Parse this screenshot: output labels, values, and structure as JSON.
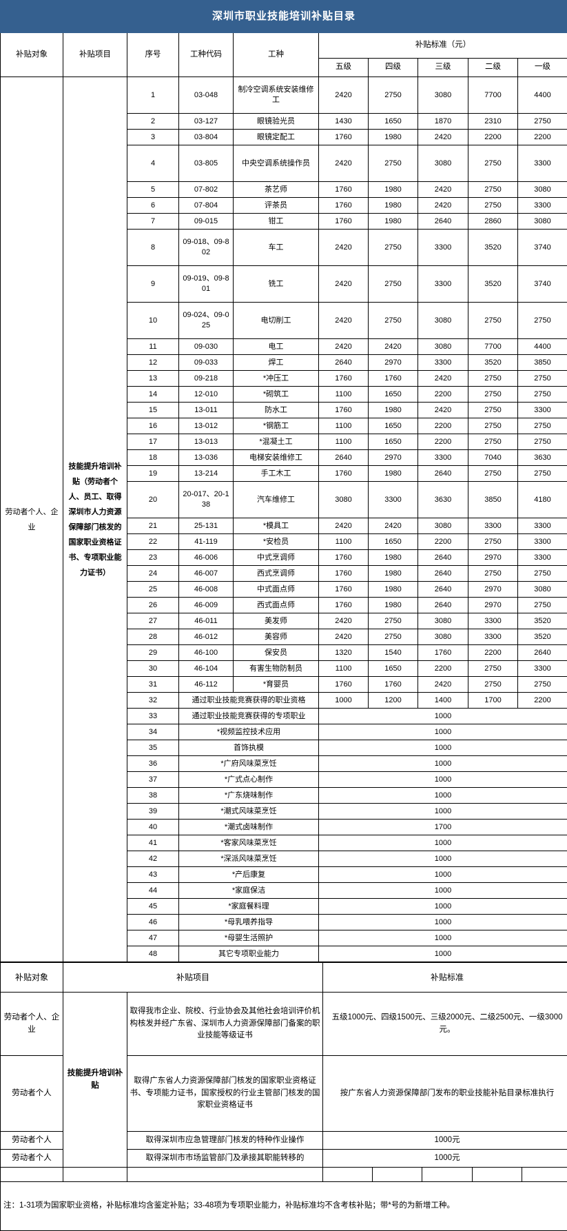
{
  "document": {
    "title": "深圳市职业技能培训补贴目录"
  },
  "table1": {
    "headers": {
      "col_object": "补贴对象",
      "col_program": "补贴项目",
      "col_index": "序号",
      "col_code": "工种代码",
      "col_trade": "工种",
      "col_standard": "补贴标准（元）",
      "levels": [
        "五级",
        "四级",
        "三级",
        "二级",
        "一级"
      ]
    },
    "category_label": "劳动者个人、企业",
    "program_label": "技能提升培训补贴（劳动者个人、员工、取得深圳市人力资源保障部门核发的国家职业资格证书、专项职业能力证书）",
    "rows": [
      {
        "no": "1",
        "code": "03-048",
        "trade": "制冷空调系统安装维修工",
        "v": [
          "2420",
          "2750",
          "3080",
          "7700",
          "4400"
        ],
        "h": "lg"
      },
      {
        "no": "2",
        "code": "03-127",
        "trade": "眼镜验光员",
        "v": [
          "1430",
          "1650",
          "1870",
          "2310",
          "2750"
        ],
        "h": "sm"
      },
      {
        "no": "3",
        "code": "03-804",
        "trade": "眼镜定配工",
        "v": [
          "1760",
          "1980",
          "2420",
          "2200",
          "2200"
        ],
        "h": "sm"
      },
      {
        "no": "4",
        "code": "03-805",
        "trade": "中央空调系统操作员",
        "v": [
          "2420",
          "2750",
          "3080",
          "2750",
          "3300"
        ],
        "h": "lg"
      },
      {
        "no": "5",
        "code": "07-802",
        "trade": "茶艺师",
        "v": [
          "1760",
          "1980",
          "2420",
          "2750",
          "3080"
        ],
        "h": "sm"
      },
      {
        "no": "6",
        "code": "07-804",
        "trade": "评茶员",
        "v": [
          "1760",
          "1980",
          "2420",
          "2750",
          "3300"
        ],
        "h": "sm"
      },
      {
        "no": "7",
        "code": "09-015",
        "trade": "钳工",
        "v": [
          "1760",
          "1980",
          "2640",
          "2860",
          "3080"
        ],
        "h": "sm"
      },
      {
        "no": "8",
        "code": "09-018、09-802",
        "trade": "车工",
        "v": [
          "2420",
          "2750",
          "3300",
          "3520",
          "3740"
        ],
        "h": "lg"
      },
      {
        "no": "9",
        "code": "09-019、09-801",
        "trade": "铣工",
        "v": [
          "2420",
          "2750",
          "3300",
          "3520",
          "3740"
        ],
        "h": "lg"
      },
      {
        "no": "10",
        "code": "09-024、09-025",
        "trade": "电切削工",
        "v": [
          "2420",
          "2750",
          "3080",
          "2750",
          "2750"
        ],
        "h": "lg"
      },
      {
        "no": "11",
        "code": "09-030",
        "trade": "电工",
        "v": [
          "2420",
          "2420",
          "3080",
          "7700",
          "4400"
        ],
        "h": "sm"
      },
      {
        "no": "12",
        "code": "09-033",
        "trade": "焊工",
        "v": [
          "2640",
          "2970",
          "3300",
          "3520",
          "3850"
        ],
        "h": "sm"
      },
      {
        "no": "13",
        "code": "09-218",
        "trade": "*冲压工",
        "v": [
          "1760",
          "1760",
          "2420",
          "2750",
          "2750"
        ],
        "h": "sm"
      },
      {
        "no": "14",
        "code": "12-010",
        "trade": "*砌筑工",
        "v": [
          "1100",
          "1650",
          "2200",
          "2750",
          "2750"
        ],
        "h": "sm"
      },
      {
        "no": "15",
        "code": "13-011",
        "trade": "防水工",
        "v": [
          "1760",
          "1980",
          "2420",
          "2750",
          "3300"
        ],
        "h": "sm"
      },
      {
        "no": "16",
        "code": "13-012",
        "trade": "*钢筋工",
        "v": [
          "1100",
          "1650",
          "2200",
          "2750",
          "2750"
        ],
        "h": "sm"
      },
      {
        "no": "17",
        "code": "13-013",
        "trade": "*混凝土工",
        "v": [
          "1100",
          "1650",
          "2200",
          "2750",
          "2750"
        ],
        "h": "sm"
      },
      {
        "no": "18",
        "code": "13-036",
        "trade": "电梯安装维修工",
        "v": [
          "2640",
          "2970",
          "3300",
          "7040",
          "3630"
        ],
        "h": "sm"
      },
      {
        "no": "19",
        "code": "13-214",
        "trade": "手工木工",
        "v": [
          "1760",
          "1980",
          "2640",
          "2750",
          "2750"
        ],
        "h": "sm"
      },
      {
        "no": "20",
        "code": "20-017、20-138",
        "trade": "汽车维修工",
        "v": [
          "3080",
          "3300",
          "3630",
          "3850",
          "4180"
        ],
        "h": "lg"
      },
      {
        "no": "21",
        "code": "25-131",
        "trade": "*模具工",
        "v": [
          "2420",
          "2420",
          "3080",
          "3300",
          "3300"
        ],
        "h": "sm"
      },
      {
        "no": "22",
        "code": "41-119",
        "trade": "*安检员",
        "v": [
          "1100",
          "1650",
          "2200",
          "2750",
          "3300"
        ],
        "h": "sm"
      },
      {
        "no": "23",
        "code": "46-006",
        "trade": "中式烹调师",
        "v": [
          "1760",
          "1980",
          "2640",
          "2970",
          "3300"
        ],
        "h": "sm"
      },
      {
        "no": "24",
        "code": "46-007",
        "trade": "西式烹调师",
        "v": [
          "1760",
          "1980",
          "2640",
          "2750",
          "2750"
        ],
        "h": "sm"
      },
      {
        "no": "25",
        "code": "46-008",
        "trade": "中式面点师",
        "v": [
          "1760",
          "1980",
          "2640",
          "2970",
          "3080"
        ],
        "h": "sm"
      },
      {
        "no": "26",
        "code": "46-009",
        "trade": "西式面点师",
        "v": [
          "1760",
          "1980",
          "2640",
          "2970",
          "2750"
        ],
        "h": "sm"
      },
      {
        "no": "27",
        "code": "46-011",
        "trade": "美发师",
        "v": [
          "2420",
          "2750",
          "3080",
          "3300",
          "3520"
        ],
        "h": "sm"
      },
      {
        "no": "28",
        "code": "46-012",
        "trade": "美容师",
        "v": [
          "2420",
          "2750",
          "3080",
          "3300",
          "3520"
        ],
        "h": "sm"
      },
      {
        "no": "29",
        "code": "46-100",
        "trade": "保安员",
        "v": [
          "1320",
          "1540",
          "1760",
          "2200",
          "2640"
        ],
        "h": "sm"
      },
      {
        "no": "30",
        "code": "46-104",
        "trade": "有害生物防制员",
        "v": [
          "1100",
          "1650",
          "2200",
          "2750",
          "3300"
        ],
        "h": "sm"
      },
      {
        "no": "31",
        "code": "46-112",
        "trade": "*育婴员",
        "v": [
          "1760",
          "1760",
          "2420",
          "2750",
          "2750"
        ],
        "h": "sm"
      }
    ],
    "wide_rows": [
      {
        "no": "32",
        "trade": "通过职业技能竞赛获得的职业资格",
        "v": [
          "1000",
          "1200",
          "1400",
          "1700",
          "2200"
        ],
        "merged": false
      },
      {
        "no": "33",
        "trade": "通过职业技能竞赛获得的专项职业",
        "value": "1000",
        "merged": true
      },
      {
        "no": "34",
        "trade": "*视频监控技术应用",
        "value": "1000",
        "merged": true
      },
      {
        "no": "35",
        "trade": "首饰执模",
        "value": "1000",
        "merged": true
      },
      {
        "no": "36",
        "trade": "*广府风味菜烹饪",
        "value": "1000",
        "merged": true
      },
      {
        "no": "37",
        "trade": "*广式点心制作",
        "value": "1000",
        "merged": true
      },
      {
        "no": "38",
        "trade": "*广东烧味制作",
        "value": "1000",
        "merged": true
      },
      {
        "no": "39",
        "trade": "*潮式风味菜烹饪",
        "value": "1000",
        "merged": true
      },
      {
        "no": "40",
        "trade": "*潮式卤味制作",
        "value": "1700",
        "merged": true
      },
      {
        "no": "41",
        "trade": "*客家风味菜烹饪",
        "value": "1000",
        "merged": true
      },
      {
        "no": "42",
        "trade": "*深派风味菜烹饪",
        "value": "1000",
        "merged": true
      },
      {
        "no": "43",
        "trade": "*产后康复",
        "value": "1000",
        "merged": true
      },
      {
        "no": "44",
        "trade": "*家庭保洁",
        "value": "1000",
        "merged": true
      },
      {
        "no": "45",
        "trade": "*家庭餐料理",
        "value": "1000",
        "merged": true
      },
      {
        "no": "46",
        "trade": "*母乳喂养指导",
        "value": "1000",
        "merged": true
      },
      {
        "no": "47",
        "trade": "*母婴生活照护",
        "value": "1000",
        "merged": true
      },
      {
        "no": "48",
        "trade": "其它专项职业能力",
        "value": "1000",
        "merged": true
      }
    ]
  },
  "table2": {
    "headers": {
      "col_object": "补贴对象",
      "col_program": "补贴项目",
      "col_standard": "补贴标准"
    },
    "program_label": "技能提升培训补贴",
    "rows": [
      {
        "object": "劳动者个人、企业",
        "program": "取得我市企业、院校、行业协会及其他社会培训评价机构核发并经广东省、深圳市人力资源保障部门备案的职业技能等级证书",
        "standard": "五级1000元、四级1500元、三级2000元、二级2500元、一级3000元。"
      },
      {
        "object": "劳动者个人",
        "program": "取得广东省人力资源保障部门核发的国家职业资格证书、专项能力证书，国家授权的行业主管部门核发的国家职业资格证书",
        "standard": "按广东省人力资源保障部门发布的职业技能补贴目录标准执行"
      },
      {
        "object": "劳动者个人",
        "program": "取得深圳市应急管理部门核发的特种作业操作",
        "standard": "1000元"
      },
      {
        "object": "劳动者个人",
        "program": "取得深圳市市场监管部门及承接其职能转移的",
        "standard": "1000元"
      }
    ]
  },
  "footer": {
    "note": "注：1-31项为国家职业资格，补贴标准均含鉴定补贴；33-48项为专项职业能力，补贴标准均不含考核补贴；带*号的为新增工种。"
  },
  "colors": {
    "header_blue": "#35608F",
    "border": "#000000",
    "background": "#FFFFFF"
  }
}
